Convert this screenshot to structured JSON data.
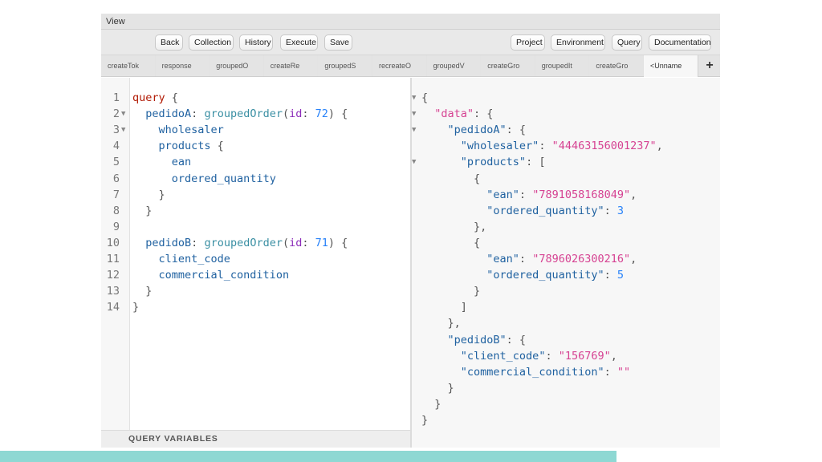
{
  "menu": {
    "view_label": "View"
  },
  "toolbar": {
    "left_buttons": [
      "Back",
      "Collection",
      "History",
      "Execute",
      "Save"
    ],
    "right_buttons": [
      "Project",
      "Environment",
      "Query",
      "Documentation"
    ]
  },
  "tabs": [
    "createTok",
    "response",
    "groupedO",
    "createRe",
    "groupedS",
    "recreateO",
    "groupedV",
    "createGro",
    "groupedIt",
    "createGro",
    "<Unname"
  ],
  "active_tab_index": 10,
  "query_variables_label": "QUERY VARIABLES",
  "query_lines": [
    [
      [
        "kw",
        "query"
      ],
      [
        "p",
        " {"
      ]
    ],
    [
      [
        "p",
        "  "
      ],
      [
        "def",
        "pedidoA"
      ],
      [
        "p",
        ": "
      ],
      [
        "fn",
        "groupedOrder"
      ],
      [
        "p",
        "("
      ],
      [
        "arg",
        "id"
      ],
      [
        "p",
        ": "
      ],
      [
        "num",
        "72"
      ],
      [
        "p",
        ") {"
      ]
    ],
    [
      [
        "p",
        "    "
      ],
      [
        "def",
        "wholesaler"
      ]
    ],
    [
      [
        "p",
        "    "
      ],
      [
        "def",
        "products"
      ],
      [
        "p",
        " {"
      ]
    ],
    [
      [
        "p",
        "      "
      ],
      [
        "def",
        "ean"
      ]
    ],
    [
      [
        "p",
        "      "
      ],
      [
        "def",
        "ordered_quantity"
      ]
    ],
    [
      [
        "p",
        "    }"
      ]
    ],
    [
      [
        "p",
        "  }"
      ]
    ],
    [],
    [
      [
        "p",
        "  "
      ],
      [
        "def",
        "pedidoB"
      ],
      [
        "p",
        ": "
      ],
      [
        "fn",
        "groupedOrder"
      ],
      [
        "p",
        "("
      ],
      [
        "arg",
        "id"
      ],
      [
        "p",
        ": "
      ],
      [
        "num",
        "71"
      ],
      [
        "p",
        ") {"
      ]
    ],
    [
      [
        "p",
        "    "
      ],
      [
        "def",
        "client_code"
      ]
    ],
    [
      [
        "p",
        "    "
      ],
      [
        "def",
        "commercial_condition"
      ]
    ],
    [
      [
        "p",
        "  }"
      ]
    ],
    [
      [
        "p",
        "}"
      ]
    ]
  ],
  "query_folds": [
    1,
    2
  ],
  "result_lines": [
    [
      [
        "p",
        "{"
      ]
    ],
    [
      [
        "p",
        "  "
      ],
      [
        "str",
        "\"data\""
      ],
      [
        "p",
        ": {"
      ]
    ],
    [
      [
        "p",
        "    "
      ],
      [
        "key",
        "\"pedidoA\""
      ],
      [
        "p",
        ": {"
      ]
    ],
    [
      [
        "p",
        "      "
      ],
      [
        "key",
        "\"wholesaler\""
      ],
      [
        "p",
        ": "
      ],
      [
        "str",
        "\"44463156001237\""
      ],
      [
        "p",
        ","
      ]
    ],
    [
      [
        "p",
        "      "
      ],
      [
        "key",
        "\"products\""
      ],
      [
        "p",
        ": ["
      ]
    ],
    [
      [
        "p",
        "        {"
      ]
    ],
    [
      [
        "p",
        "          "
      ],
      [
        "key",
        "\"ean\""
      ],
      [
        "p",
        ": "
      ],
      [
        "str",
        "\"7891058168049\""
      ],
      [
        "p",
        ","
      ]
    ],
    [
      [
        "p",
        "          "
      ],
      [
        "key",
        "\"ordered_quantity\""
      ],
      [
        "p",
        ": "
      ],
      [
        "num",
        "3"
      ]
    ],
    [
      [
        "p",
        "        },"
      ]
    ],
    [
      [
        "p",
        "        {"
      ]
    ],
    [
      [
        "p",
        "          "
      ],
      [
        "key",
        "\"ean\""
      ],
      [
        "p",
        ": "
      ],
      [
        "str",
        "\"7896026300216\""
      ],
      [
        "p",
        ","
      ]
    ],
    [
      [
        "p",
        "          "
      ],
      [
        "key",
        "\"ordered_quantity\""
      ],
      [
        "p",
        ": "
      ],
      [
        "num",
        "5"
      ]
    ],
    [
      [
        "p",
        "        }"
      ]
    ],
    [
      [
        "p",
        "      ]"
      ]
    ],
    [
      [
        "p",
        "    },"
      ]
    ],
    [
      [
        "p",
        "    "
      ],
      [
        "key",
        "\"pedidoB\""
      ],
      [
        "p",
        ": {"
      ]
    ],
    [
      [
        "p",
        "      "
      ],
      [
        "key",
        "\"client_code\""
      ],
      [
        "p",
        ": "
      ],
      [
        "str",
        "\"156769\""
      ],
      [
        "p",
        ","
      ]
    ],
    [
      [
        "p",
        "      "
      ],
      [
        "key",
        "\"commercial_condition\""
      ],
      [
        "p",
        ": "
      ],
      [
        "str",
        "\"\""
      ]
    ],
    [
      [
        "p",
        "    }"
      ]
    ],
    [
      [
        "p",
        "  }"
      ]
    ],
    [
      [
        "p",
        "}"
      ]
    ]
  ],
  "result_folds": [
    0,
    1,
    2,
    4
  ],
  "colors": {
    "accent_bar": "#8ed8d3",
    "keyword": "#b11a04",
    "field": "#1f61a0",
    "string": "#d64292",
    "number": "#2882f9"
  }
}
